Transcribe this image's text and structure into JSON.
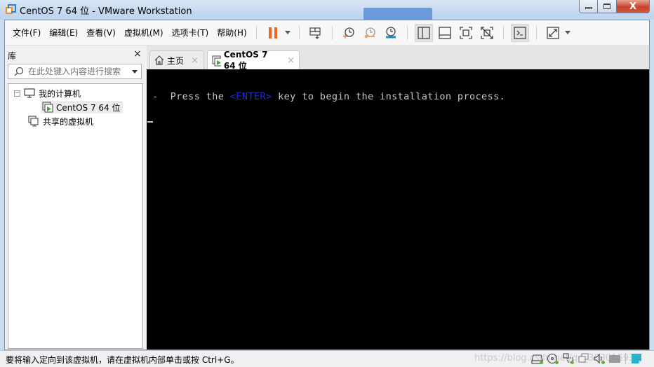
{
  "window": {
    "title": "CentOS 7 64 位 - VMware Workstation",
    "minimize_glyph": "—",
    "close_glyph": "X"
  },
  "menu": {
    "items": [
      {
        "label": "文件(F)"
      },
      {
        "label": "编辑(E)"
      },
      {
        "label": "查看(V)"
      },
      {
        "label": "虚拟机(M)"
      },
      {
        "label": "选项卡(T)"
      },
      {
        "label": "帮助(H)"
      }
    ]
  },
  "toolbar": {
    "icons": [
      "pause-icon",
      "send-ctrl-alt-del-icon",
      "take-snapshot-icon",
      "revert-snapshot-icon",
      "snapshot-manager-icon",
      "show-library-icon",
      "show-thumbnail-bar-icon",
      "full-screen-icon",
      "unity-icon",
      "console-view-icon",
      "stretch-guest-icon"
    ],
    "colors": {
      "pause": "#f06522",
      "snapshot_add": "#e67a2e",
      "revert": "#f0a070",
      "manager": "#1a8fc7"
    }
  },
  "library": {
    "title": "库",
    "close_glyph": "×",
    "search_placeholder": "在此处键入内容进行搜索",
    "tree": [
      {
        "label": "我的计算机",
        "expander": "−"
      },
      {
        "label": "CentOS 7 64 位",
        "selected": true
      },
      {
        "label": "共享的虚拟机"
      }
    ]
  },
  "tabs": [
    {
      "label": "主页",
      "close": "×",
      "active": false
    },
    {
      "label": "CentOS 7 64 位",
      "close": "×",
      "active": true
    }
  ],
  "console": {
    "prefix": "-  Press the ",
    "enter_key": "<ENTER>",
    "suffix": " key to begin the installation process.",
    "enter_color": "#1e2fc8"
  },
  "statusbar": {
    "message": "要将输入定向到该虚拟机，请在虚拟机内部单击或按 Ctrl+G。",
    "watermark": "https://blog.csdn.net/qq_36301693",
    "device_icons": [
      "hard-disk-icon",
      "cd-dvd-icon",
      "network-adapter-icon",
      "usb-icon",
      "sound-icon",
      "display-icon",
      "message-icon"
    ]
  }
}
